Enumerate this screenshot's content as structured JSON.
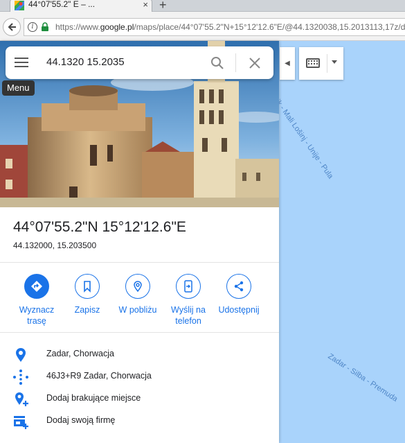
{
  "browser": {
    "tab_title": "44°07'55.2\" E – ...",
    "tab_close": "×",
    "newtab": "+",
    "url_prefix": "https://www.",
    "url_domain": "google.pl",
    "url_rest": "/maps/place/44°07'55.2\"N+15°12'12.6\"E/@44.1320038,15.2013113,17z/da"
  },
  "search": {
    "value": "44.1320 15.2035",
    "menu_tooltip": "Menu"
  },
  "place": {
    "title": "44°07'55.2\"N 15°12'12.6\"E",
    "decimal": "44.132000, 15.203500"
  },
  "actions": [
    {
      "label": "Wyznacz trasę",
      "icon": "directions-icon"
    },
    {
      "label": "Zapisz",
      "icon": "bookmark-icon"
    },
    {
      "label": "W pobliżu",
      "icon": "nearby-icon"
    },
    {
      "label": "Wyślij na telefon",
      "icon": "send-to-phone-icon"
    },
    {
      "label": "Udostępnij",
      "icon": "share-icon"
    }
  ],
  "info": [
    {
      "text": "Zadar, Chorwacja",
      "icon": "location-pin-icon"
    },
    {
      "text": "46J3+R9 Zadar, Chorwacja",
      "icon": "plus-code-icon"
    },
    {
      "text": "Dodaj brakujące miejsce",
      "icon": "add-place-icon"
    },
    {
      "text": "Dodaj swoją firmę",
      "icon": "add-business-icon"
    }
  ],
  "map": {
    "ferry_label_1": "vik - Mali Lošinj - Unije - Pula",
    "ferry_label_2": "Zadar - Silba - Premuda"
  },
  "colors": {
    "accent": "#1a73e8",
    "water": "#a9d3fb"
  }
}
